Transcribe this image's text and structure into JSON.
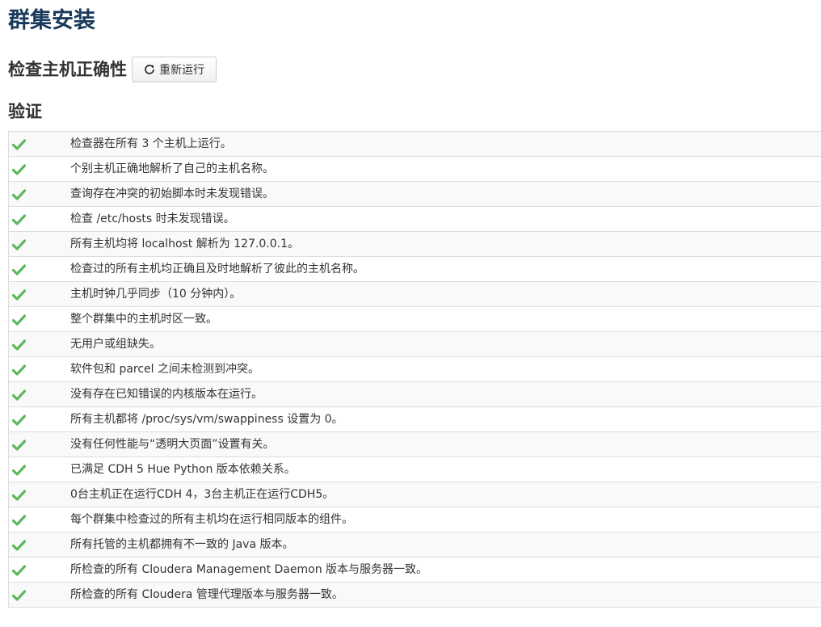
{
  "page": {
    "title": "群集安装"
  },
  "section": {
    "title": "检查主机正确性",
    "rerun_label": "重新运行",
    "rerun_icon": "refresh-icon"
  },
  "validation": {
    "title": "验证",
    "status_color": "#5cb85c",
    "status_icon": "check-icon",
    "checks": [
      "检查器在所有 3 个主机上运行。",
      "个别主机正确地解析了自己的主机名称。",
      "查询存在冲突的初始脚本时未发现错误。",
      "检查 /etc/hosts 时未发现错误。",
      "所有主机均将 localhost 解析为 127.0.0.1。",
      "检查过的所有主机均正确且及时地解析了彼此的主机名称。",
      "主机时钟几乎同步（10 分钟内）。",
      "整个群集中的主机时区一致。",
      "无用户或组缺失。",
      "软件包和 parcel 之间未检测到冲突。",
      "没有存在已知错误的内核版本在运行。",
      "所有主机都将 /proc/sys/vm/swappiness 设置为 0。",
      "没有任何性能与“透明大页面”设置有关。",
      "已满足 CDH 5 Hue Python 版本依赖关系。",
      "0台主机正在运行CDH 4，3台主机正在运行CDH5。",
      "每个群集中检查过的所有主机均在运行相同版本的组件。",
      "所有托管的主机都拥有不一致的 Java 版本。",
      "所检查的所有 Cloudera Management Daemon 版本与服务器一致。",
      "所检查的所有 Cloudera 管理代理版本与服务器一致。"
    ]
  }
}
